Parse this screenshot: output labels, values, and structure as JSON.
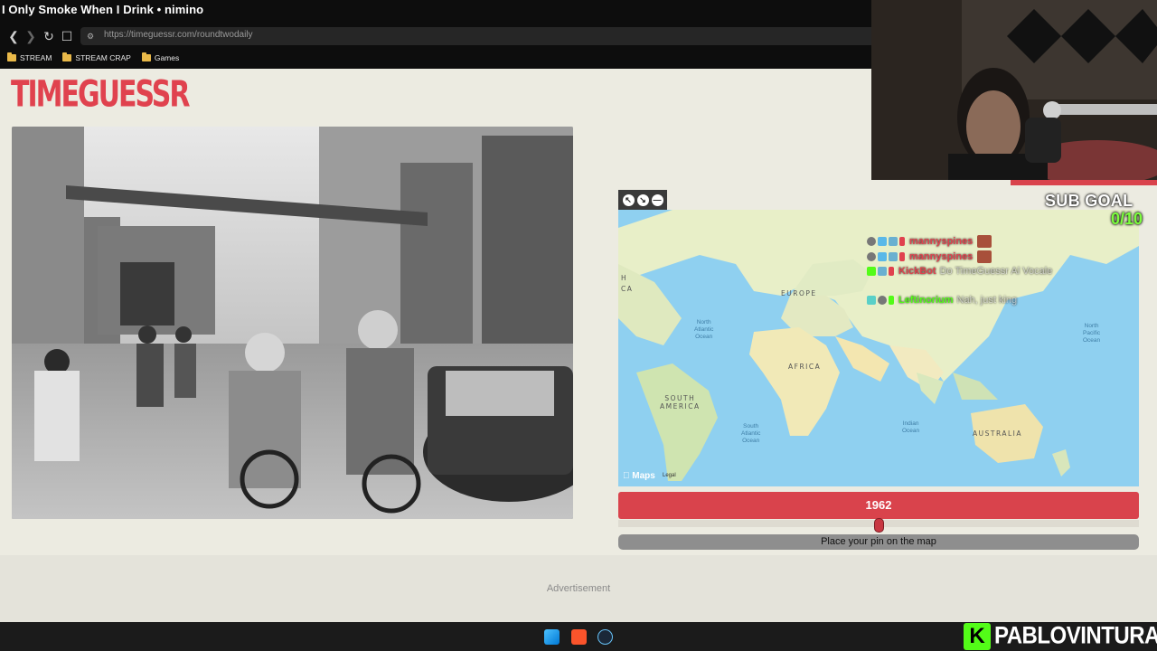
{
  "browser": {
    "tab_title": "I Only Smoke When I Drink • nimino",
    "url": "https://timeguessr.com/roundtwodaily",
    "bookmarks": [
      "STREAM",
      "STREAM CRAP",
      "Games"
    ]
  },
  "site": {
    "logo": "TIMEGUESSR",
    "advertisement": "Advertisement"
  },
  "map": {
    "continents": [
      "EUROPE",
      "AFRICA",
      "SOUTH\nAMERICA",
      "AUSTRALIA"
    ],
    "oceans": [
      "North\nAtlantic\nOcean",
      "North\nPacific\nOcean",
      "South\nAtlantic\nOcean",
      "Indian\nOcean"
    ],
    "edge_label": "H\nCA",
    "maps_logo": " Maps",
    "legal": "Legal"
  },
  "slider": {
    "year": "1962",
    "pin_prompt": "Place your pin on the map",
    "year_fraction": 0.5
  },
  "overlay": {
    "sub_goal_label": "SUB GOAL",
    "sub_goal_count": "0/10",
    "chat": [
      {
        "user": "mannyspines",
        "message": "",
        "color": "#e0424e"
      },
      {
        "user": "mannyspines",
        "message": "",
        "color": "#e0424e"
      },
      {
        "user": "KickBot",
        "message": "Do TimeGuessr Al Vocale",
        "color": "#e0424e"
      },
      {
        "user": "Leftinorium",
        "message": "Nah, just king",
        "color": "#53fc18"
      }
    ],
    "streamer": "PABLOVINTURA",
    "kick_letter": "K"
  }
}
